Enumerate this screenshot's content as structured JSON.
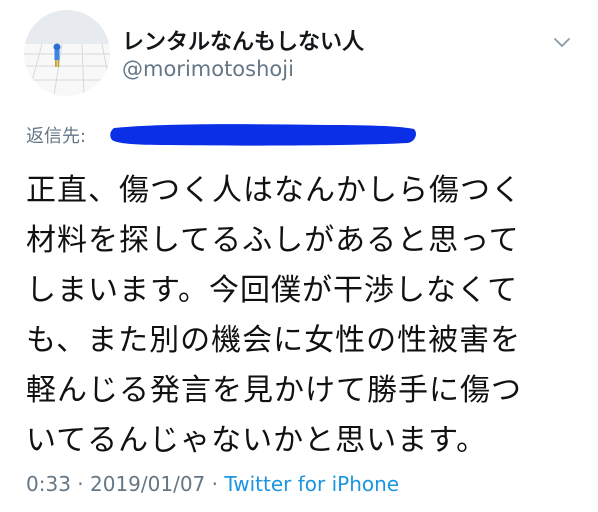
{
  "author": {
    "display_name": "レンタルなんもしない人",
    "username": "@morimotoshoji"
  },
  "reply": {
    "label": "返信先:",
    "redacted_color": "#0a2fe6"
  },
  "tweet": {
    "lines": [
      "正直、傷つく人はなんかしら傷つく",
      "材料を探してるふしがあると思って",
      "しまいます。今回僕が干渉しなくて",
      "も、また別の機会に女性の性被害を",
      "軽んじる発言を見かけて勝手に傷つ",
      "いてるんじゃないかと思います。"
    ]
  },
  "meta": {
    "time": "0:33",
    "separator": "·",
    "date": "2019/01/07",
    "source": "Twitter for iPhone"
  },
  "icons": {
    "avatar": "avatar-image",
    "menu": "chevron-down-icon"
  },
  "colors": {
    "link": "#1b95e0",
    "secondary_text": "#657786",
    "primary_text": "#14171a"
  }
}
